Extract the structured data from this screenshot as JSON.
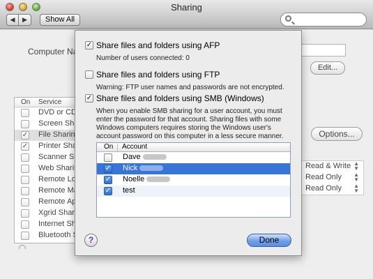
{
  "window": {
    "title": "Sharing"
  },
  "toolbar": {
    "back_label": "◀",
    "forward_label": "▶",
    "show_all_label": "Show All"
  },
  "pane": {
    "computer_name_label": "Computer Na",
    "edit_label": "Edit...",
    "services_table": {
      "headers": {
        "on": "On",
        "service": "Service"
      },
      "rows": [
        {
          "name": "DVD or CD",
          "checked": false
        },
        {
          "name": "Screen Sha",
          "checked": false
        },
        {
          "name": "File Sharing",
          "checked": true
        },
        {
          "name": "Printer Sha",
          "checked": true
        },
        {
          "name": "Scanner Sh",
          "checked": false
        },
        {
          "name": "Web Sharin",
          "checked": false
        },
        {
          "name": "Remote Log",
          "checked": false
        },
        {
          "name": "Remote Ma",
          "checked": false
        },
        {
          "name": "Remote Ap",
          "checked": false
        },
        {
          "name": "Xgrid Shari",
          "checked": false
        },
        {
          "name": "Internet Sh",
          "checked": false
        },
        {
          "name": "Bluetooth S",
          "checked": false
        }
      ]
    },
    "options_label": "Options...",
    "permissions": [
      "Read & Write",
      "Read Only",
      "Read Only"
    ]
  },
  "sheet": {
    "afp": {
      "label": "Share files and folders using AFP",
      "checked": true,
      "note": "Number of users connected: 0"
    },
    "ftp": {
      "label": "Share files and folders using FTP",
      "checked": false,
      "note": "Warning: FTP user names and passwords are not encrypted."
    },
    "smb": {
      "label": "Share files and folders using SMB (Windows)",
      "checked": true,
      "description": "When you enable SMB sharing for a user account, you must enter the password for that account. Sharing files with some Windows computers requires storing the Windows user's account password on this computer in a less secure manner."
    },
    "accounts_table": {
      "headers": {
        "on": "On",
        "account": "Account"
      },
      "rows": [
        {
          "name": "Dave",
          "checked": false,
          "selected": false
        },
        {
          "name": "Nick",
          "checked": true,
          "selected": true
        },
        {
          "name": "Noelle",
          "checked": true,
          "selected": false
        },
        {
          "name": "test",
          "checked": true,
          "selected": false
        }
      ]
    },
    "help_label": "?",
    "done_label": "Done"
  },
  "check_glyph": "✓"
}
